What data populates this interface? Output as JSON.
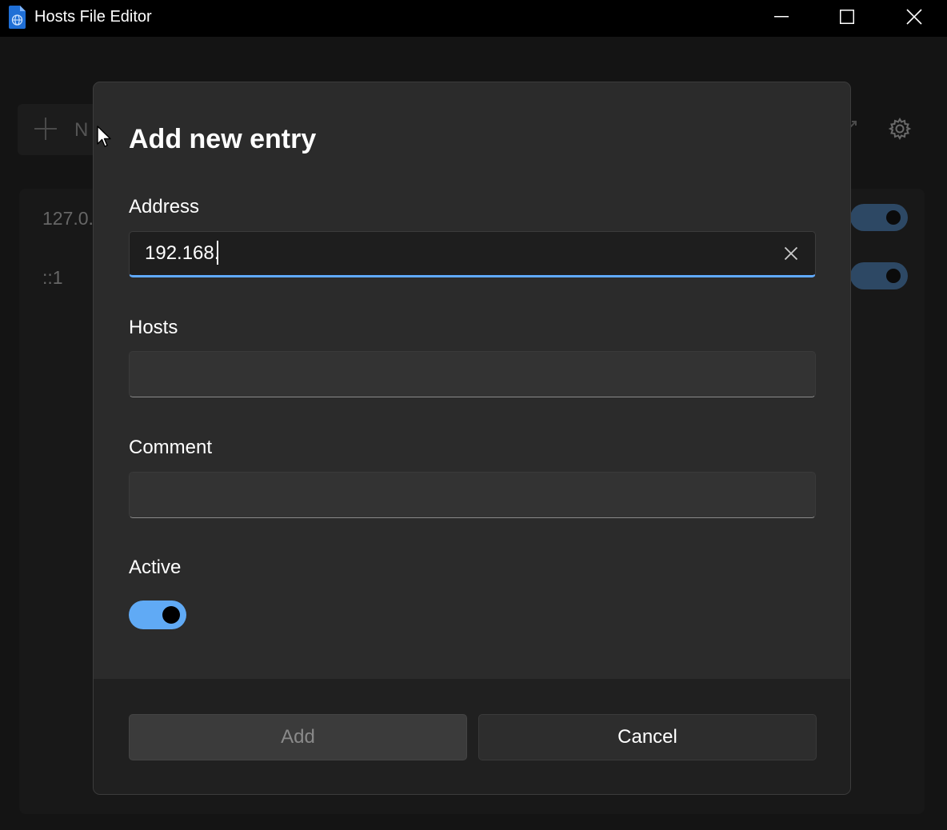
{
  "window": {
    "title": "Hosts File Editor",
    "minimize_label": "Minimize",
    "maximize_label": "Maximize",
    "close_label": "Close"
  },
  "background": {
    "new_entry_partial": "N",
    "entries": [
      {
        "address": "127.0.",
        "active": true
      },
      {
        "address": "::1",
        "active": true
      }
    ]
  },
  "dialog": {
    "title": "Add new entry",
    "address": {
      "label": "Address",
      "value": "192.168."
    },
    "hosts": {
      "label": "Hosts",
      "value": ""
    },
    "comment": {
      "label": "Comment",
      "value": ""
    },
    "active": {
      "label": "Active",
      "on": true
    },
    "buttons": {
      "add": "Add",
      "cancel": "Cancel"
    }
  },
  "colors": {
    "accent": "#60aaff",
    "toggle_on": "#60aaf5",
    "dialog_bg": "#2b2b2b",
    "footer_bg": "#202020"
  },
  "icons": {
    "app": "hosts-file-icon",
    "clear": "close-icon",
    "settings": "gear-icon",
    "add": "plus-icon"
  }
}
